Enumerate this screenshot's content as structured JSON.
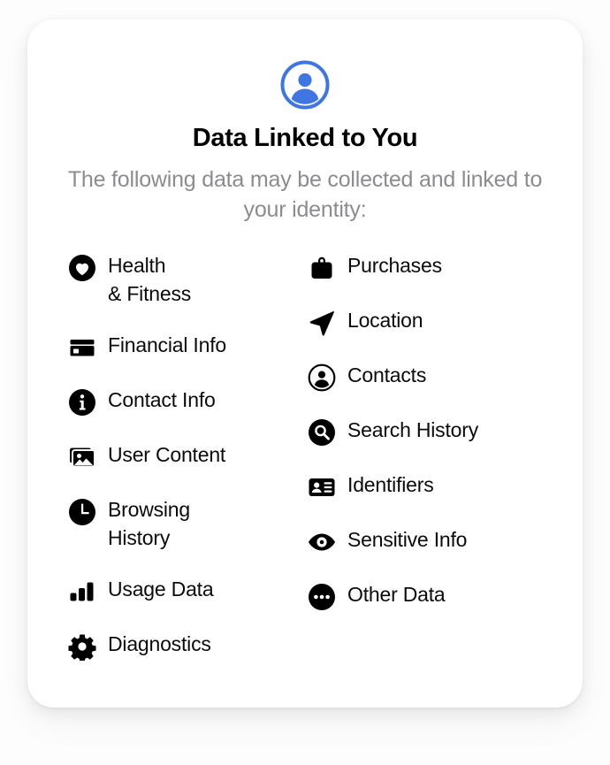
{
  "card": {
    "avatar_icon": "person-circle-icon",
    "title": "Data Linked to You",
    "subtitle": "The following data may be collected and linked to your identity:",
    "accent_color": "#3f76e4",
    "icon_color": "#000000",
    "subtitle_color": "#8c8c90",
    "card_background": "#ffffff",
    "page_background": "#fdfdfd"
  },
  "columns": {
    "left": [
      {
        "label": "Health\n& Fitness",
        "icon": "heart-circle-icon"
      },
      {
        "label": "Financial Info",
        "icon": "credit-card-icon"
      },
      {
        "label": "Contact Info",
        "icon": "info-circle-icon"
      },
      {
        "label": "User Content",
        "icon": "photos-stack-icon"
      },
      {
        "label": "Browsing\nHistory",
        "icon": "clock-icon"
      },
      {
        "label": "Usage Data",
        "icon": "bar-chart-icon"
      },
      {
        "label": "Diagnostics",
        "icon": "gear-icon"
      }
    ],
    "right": [
      {
        "label": "Purchases",
        "icon": "shopping-bag-icon"
      },
      {
        "label": "Location",
        "icon": "navigation-arrow-icon"
      },
      {
        "label": "Contacts",
        "icon": "person-circle-outline-icon"
      },
      {
        "label": "Search History",
        "icon": "search-circle-icon"
      },
      {
        "label": "Identifiers",
        "icon": "id-card-icon"
      },
      {
        "label": "Sensitive Info",
        "icon": "eye-icon"
      },
      {
        "label": "Other Data",
        "icon": "ellipsis-circle-icon"
      }
    ]
  }
}
